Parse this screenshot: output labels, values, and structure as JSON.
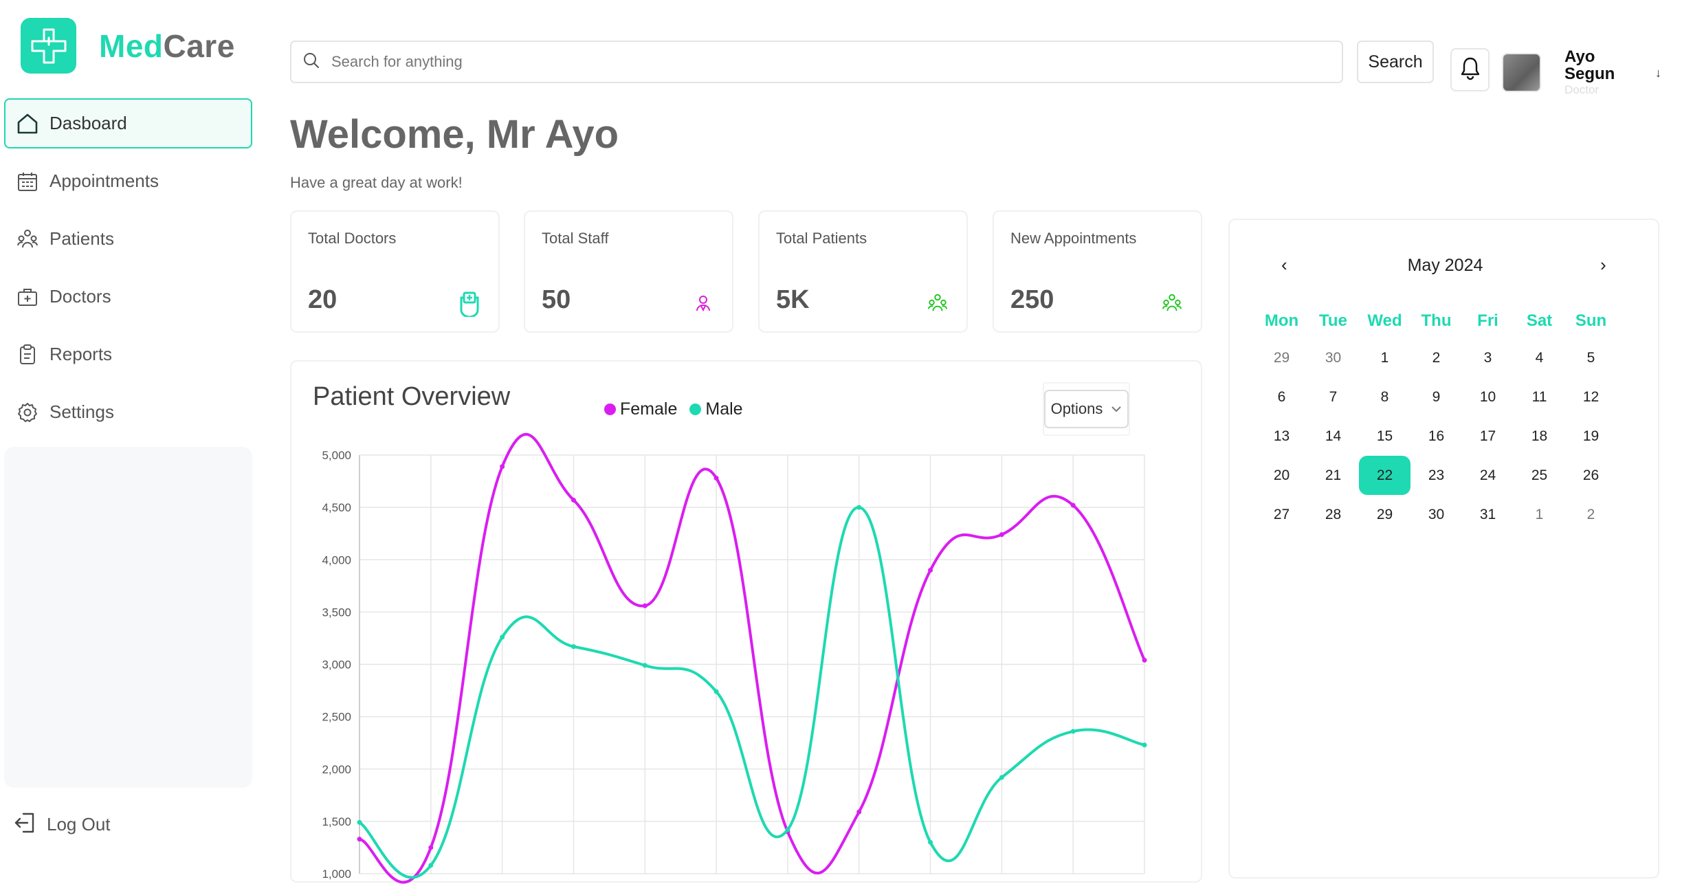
{
  "app": {
    "name_part1": "Med",
    "name_part2": "Care"
  },
  "sidebar": {
    "items": [
      {
        "label": "Dasboard",
        "icon": "home-icon",
        "active": true
      },
      {
        "label": "Appointments",
        "icon": "calendar-icon"
      },
      {
        "label": "Patients",
        "icon": "patients-icon"
      },
      {
        "label": "Doctors",
        "icon": "medical-bag-icon"
      },
      {
        "label": "Reports",
        "icon": "clipboard-icon"
      },
      {
        "label": "Settings",
        "icon": "gear-icon"
      }
    ],
    "logout_label": "Log Out"
  },
  "header": {
    "search_placeholder": "Search for anything",
    "search_button": "Search",
    "user_first": "Ayo",
    "user_last": "Segun",
    "user_role": "Doctor",
    "caret": "↓"
  },
  "welcome": {
    "title": "Welcome, Mr Ayo",
    "subtitle": "Have a great day at work!"
  },
  "stats": [
    {
      "title": "Total Doctors",
      "value": "20",
      "icon": "medical-bag-icon",
      "color": "#1ed9b1"
    },
    {
      "title": "Total Staff",
      "value": "50",
      "icon": "staff-icon",
      "color": "#d91ed9"
    },
    {
      "title": "Total Patients",
      "value": "5K",
      "icon": "patients-icon",
      "color": "#1ec41e"
    },
    {
      "title": "New Appointments",
      "value": "250",
      "icon": "patients-icon",
      "color": "#1ec41e"
    }
  ],
  "chart": {
    "title": "Patient Overview",
    "options_label": "Options",
    "legend": [
      {
        "name": "Female",
        "color": "#d91ef0"
      },
      {
        "name": "Male",
        "color": "#1ed9b1"
      }
    ]
  },
  "chart_data": {
    "type": "line",
    "title": "Patient Overview",
    "ylim": [
      1000,
      5000
    ],
    "yticks": [
      "5,000",
      "4,500",
      "4,000",
      "3,500",
      "3,000",
      "2,500",
      "2,000",
      "1,500",
      "1,000"
    ],
    "grid": true,
    "legend_position": "top",
    "series": [
      {
        "name": "Female",
        "color": "#d91ef0",
        "values": [
          1330,
          1250,
          4890,
          4570,
          3560,
          4780,
          1400,
          1590,
          3900,
          4240,
          4520,
          3040
        ]
      },
      {
        "name": "Male",
        "color": "#1ed9b1",
        "values": [
          1490,
          1080,
          3260,
          3170,
          2990,
          2740,
          1420,
          4500,
          1300,
          1920,
          2360,
          2230
        ]
      }
    ]
  },
  "calendar": {
    "month_label": "May 2024",
    "prev": "‹",
    "next": "›",
    "weekdays": [
      "Mon",
      "Tue",
      "Wed",
      "Thu",
      "Fri",
      "Sat",
      "Sun"
    ],
    "days": [
      {
        "d": "29",
        "m": true
      },
      {
        "d": "30",
        "m": true
      },
      {
        "d": "1"
      },
      {
        "d": "2"
      },
      {
        "d": "3"
      },
      {
        "d": "4"
      },
      {
        "d": "5"
      },
      {
        "d": "6"
      },
      {
        "d": "7"
      },
      {
        "d": "8"
      },
      {
        "d": "9"
      },
      {
        "d": "10"
      },
      {
        "d": "11"
      },
      {
        "d": "12"
      },
      {
        "d": "13"
      },
      {
        "d": "14"
      },
      {
        "d": "15"
      },
      {
        "d": "16"
      },
      {
        "d": "17"
      },
      {
        "d": "18"
      },
      {
        "d": "19"
      },
      {
        "d": "20"
      },
      {
        "d": "21"
      },
      {
        "d": "22",
        "s": true
      },
      {
        "d": "23"
      },
      {
        "d": "24"
      },
      {
        "d": "25"
      },
      {
        "d": "26"
      },
      {
        "d": "27"
      },
      {
        "d": "28"
      },
      {
        "d": "29"
      },
      {
        "d": "30"
      },
      {
        "d": "31"
      },
      {
        "d": "1",
        "m": true
      },
      {
        "d": "2",
        "m": true
      }
    ]
  }
}
